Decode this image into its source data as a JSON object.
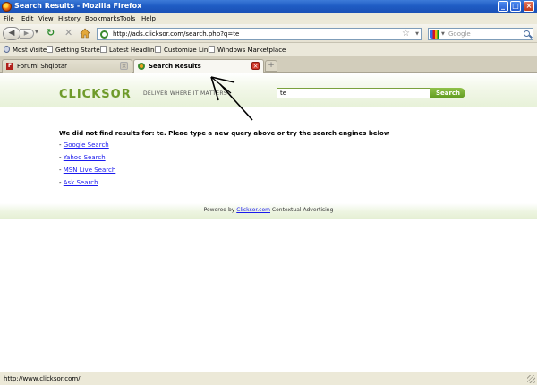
{
  "window": {
    "title": "Search Results - Mozilla Firefox",
    "buttons": [
      "_",
      "□",
      "×"
    ]
  },
  "menu": [
    "File",
    "Edit",
    "View",
    "History",
    "Bookmarks",
    "Tools",
    "Help"
  ],
  "nav": {
    "url": "http://ads.clicksor.com/search.php?q=te",
    "search_engine": "Google",
    "search_placeholder": "Google"
  },
  "bookmarks": [
    "Most Visited",
    "Getting Started",
    "Latest Headlines",
    "Customize Links",
    "Windows Marketplace"
  ],
  "tabs": [
    {
      "label": "Forumi Shqiptar",
      "active": false
    },
    {
      "label": "Search Results",
      "active": true
    }
  ],
  "page": {
    "logo": "CLICKSOR",
    "tagline": "DELIVER WHERE IT MATTERS",
    "search_value": "te",
    "search_button": "Search",
    "message": "We did not find results for: te. Pleae type a new query above or try the search engines below",
    "engines": [
      "Google Search",
      "Yahoo Search",
      "MSN Live Search",
      "Ask Search"
    ],
    "engine_prefix": "- ",
    "footer_prefix": "Powered by ",
    "footer_link": "Clicksor.com",
    "footer_suffix": " Contextual Advertising"
  },
  "status": {
    "text": "http://www.clicksor.com/"
  },
  "colors": {
    "brand_green": "#6e9a2a",
    "titlebar_blue": "#1f5cc4",
    "link_blue": "#1a1aee"
  }
}
